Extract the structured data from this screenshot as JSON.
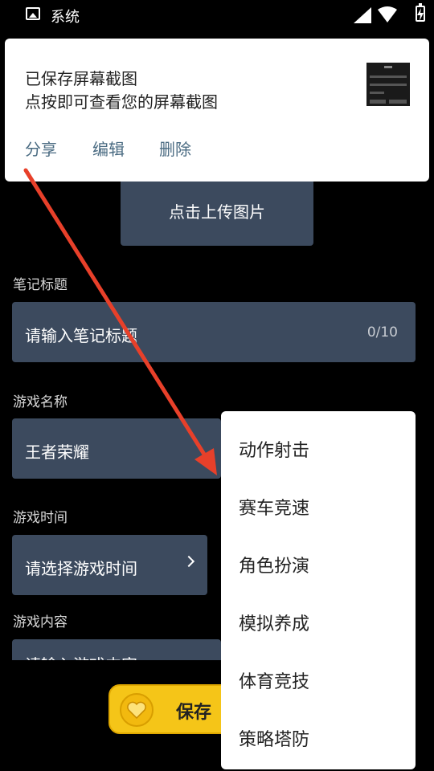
{
  "status_bar": {
    "title": "系统"
  },
  "notification": {
    "title": "已保存屏幕截图",
    "subtitle": "点按即可查看您的屏幕截图",
    "actions": [
      "分享",
      "编辑",
      "删除"
    ]
  },
  "upload": {
    "label": "点击上传图片"
  },
  "note_title": {
    "label": "笔记标题",
    "placeholder": "请输入笔记标题",
    "counter": "0/10"
  },
  "game_name": {
    "label": "游戏名称",
    "value": "王者荣耀"
  },
  "game_time": {
    "label": "游戏时间",
    "placeholder": "请选择游戏时间"
  },
  "game_content": {
    "label": "游戏内容",
    "placeholder": "请输入游戏内容"
  },
  "save": {
    "label": "保存"
  },
  "menu": {
    "items": [
      "动作射击",
      "赛车竞速",
      "角色扮演",
      "模拟养成",
      "体育竞技",
      "策略塔防"
    ]
  },
  "colors": {
    "field": "#3c4a5e",
    "accent_arrow": "#e8402a",
    "save_button": "#f5c518"
  }
}
